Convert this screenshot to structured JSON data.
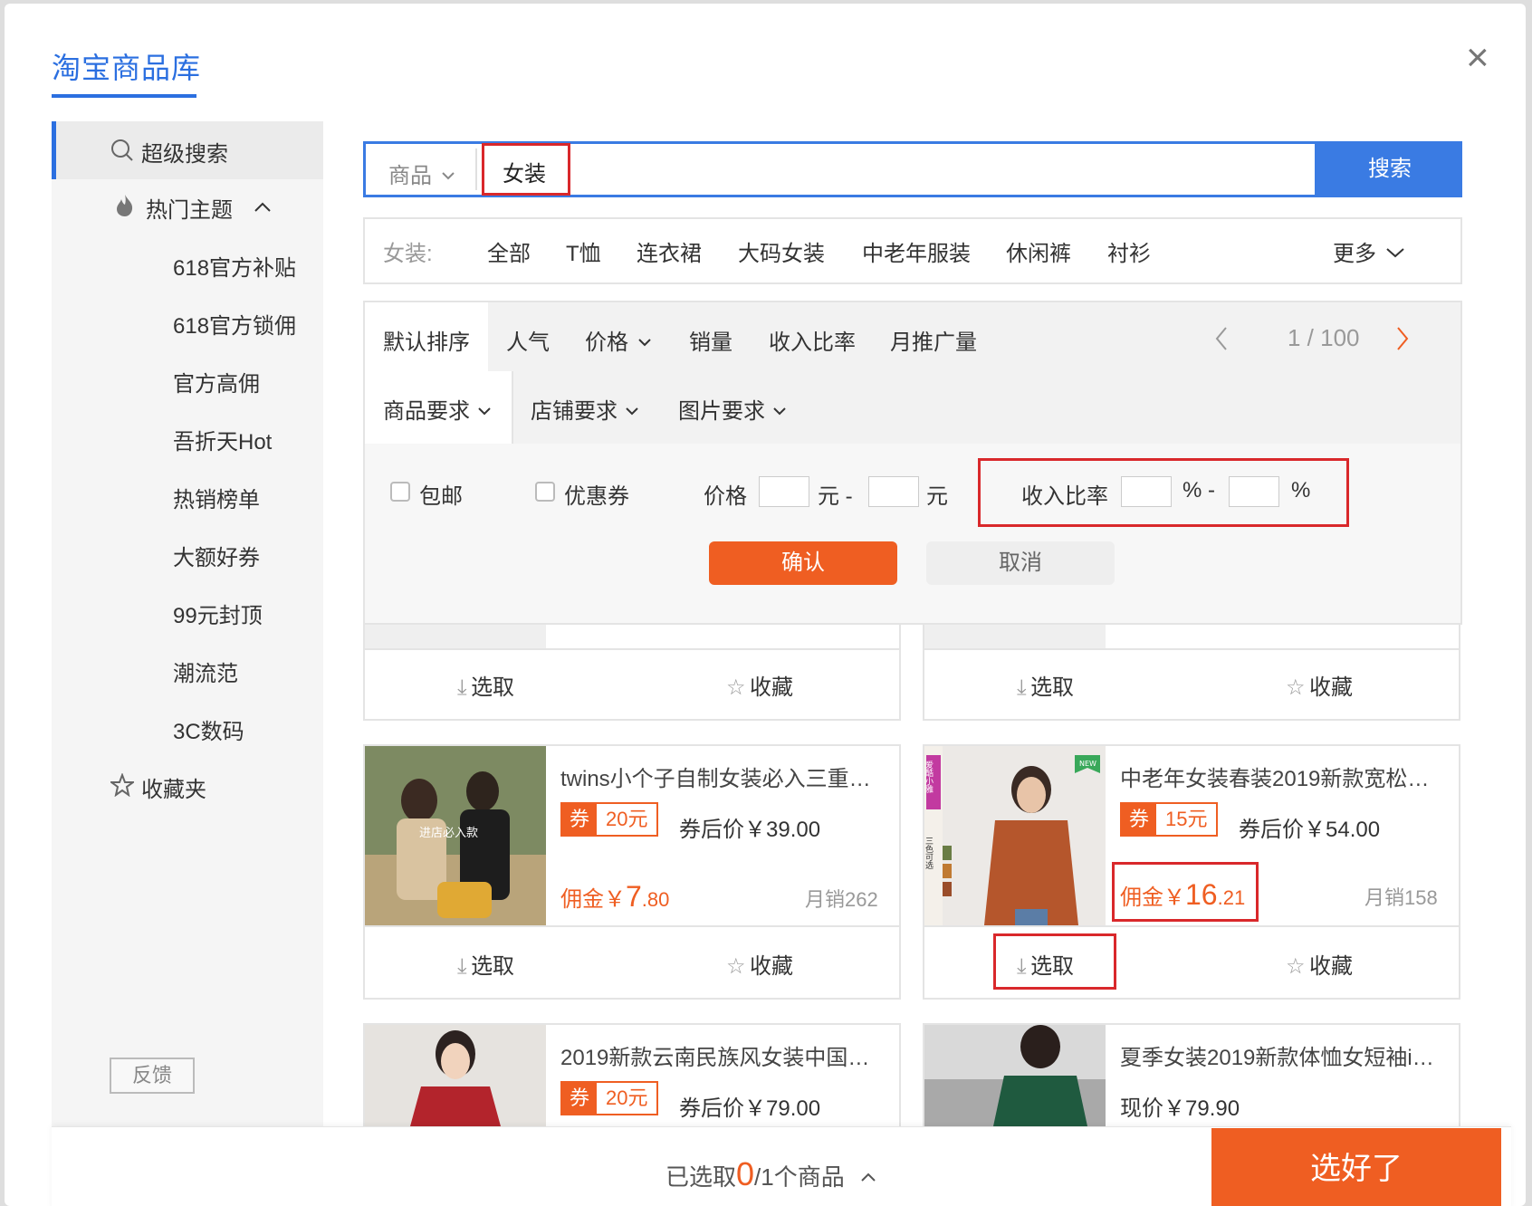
{
  "modal": {
    "title": "淘宝商品库",
    "close_symbol": "×"
  },
  "sidebar": {
    "items": [
      {
        "label": "超级搜索"
      },
      {
        "label": "热门主题"
      },
      {
        "label": "618官方补贴"
      },
      {
        "label": "618官方锁佣"
      },
      {
        "label": "官方高佣"
      },
      {
        "label": "吾折天Hot"
      },
      {
        "label": "热销榜单"
      },
      {
        "label": "大额好券"
      },
      {
        "label": "99元封顶"
      },
      {
        "label": "潮流范"
      },
      {
        "label": "3C数码"
      },
      {
        "label": "收藏夹"
      }
    ],
    "feedback": "反馈"
  },
  "search": {
    "type_label": "商品",
    "query": "女装",
    "button": "搜索"
  },
  "categories": {
    "prefix": "女装:",
    "items": [
      "全部",
      "T恤",
      "连衣裙",
      "大码女装",
      "中老年服装",
      "休闲裤",
      "衬衫"
    ],
    "more": "更多"
  },
  "sort": {
    "items": [
      "默认排序",
      "人气",
      "价格",
      "销量",
      "收入比率",
      "月推广量"
    ],
    "page": "1 / 100"
  },
  "requirements": {
    "items": [
      "商品要求",
      "店铺要求",
      "图片要求"
    ]
  },
  "conditions": {
    "free_shipping": "包邮",
    "coupon": "优惠券",
    "price_label": "价格",
    "yuan_dash": "元 -",
    "yuan": "元",
    "rate_label": "收入比率",
    "pct_dash": "% -",
    "pct": "%",
    "confirm": "确认",
    "cancel": "取消"
  },
  "actions": {
    "select": "选取",
    "favorite": "收藏"
  },
  "products": [
    {
      "title": "twins小个子自制女装必入三重…",
      "coupon_tag": "券",
      "coupon_value": "20元",
      "after_price": "券后价￥39.00",
      "commission_prefix": "佣金￥",
      "commission_int": "7",
      "commission_dec": ".80",
      "sales": "月销262",
      "image_caption": "进店必入款"
    },
    {
      "title": "中老年女装春装2019新款宽松…",
      "coupon_tag": "券",
      "coupon_value": "15元",
      "after_price": "券后价￥54.00",
      "commission_prefix": "佣金￥",
      "commission_int": "16",
      "commission_dec": ".21",
      "sales": "月销158",
      "image_badge": "NEW",
      "image_side": "爱酷小雅",
      "image_note": "三色可选"
    },
    {
      "title": "2019新款云南民族风女装中国…",
      "coupon_tag": "券",
      "coupon_value": "20元",
      "after_price": "券后价￥79.00"
    },
    {
      "title": "夏季女装2019新款体恤女短袖i…",
      "current_price": "现价￥79.90"
    }
  ],
  "footer": {
    "selected_prefix": "已选取",
    "selected_count": "0",
    "selected_suffix": "/1个商品",
    "done": "选好了"
  },
  "colors": {
    "accent_blue": "#2b6fe0",
    "accent_orange": "#ef5e22",
    "highlight_red": "#d9282b"
  }
}
